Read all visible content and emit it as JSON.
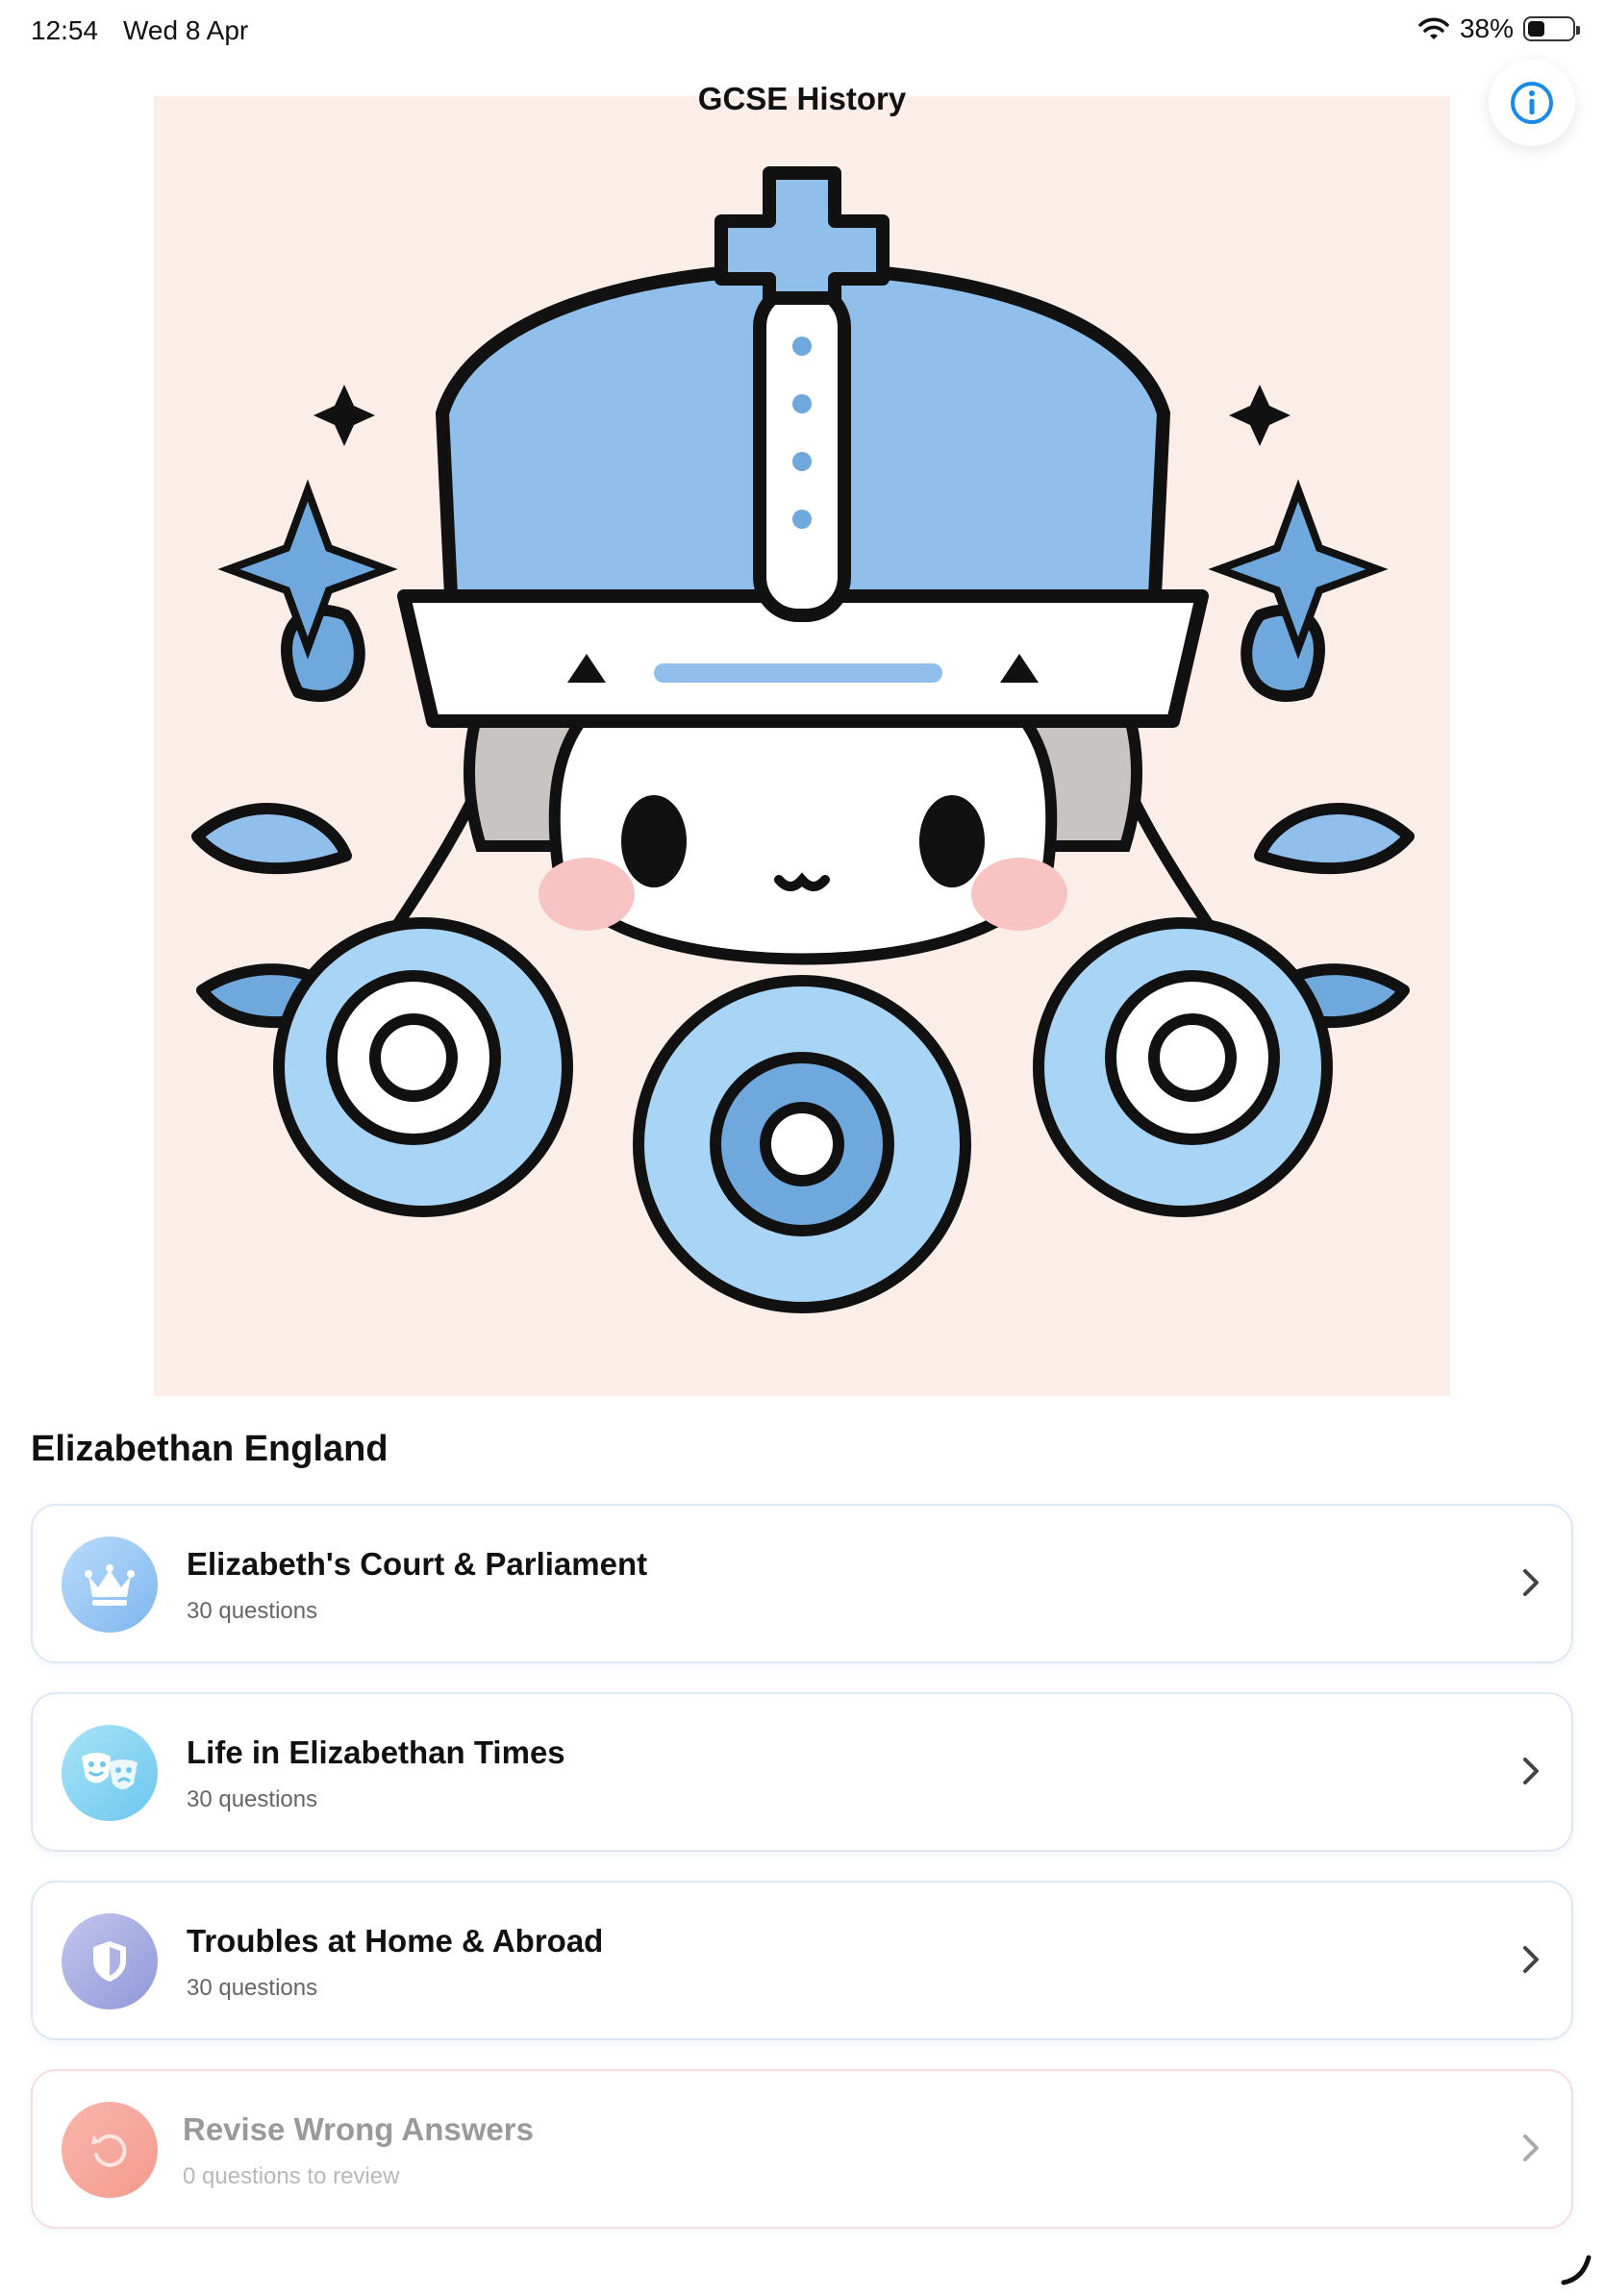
{
  "status_bar": {
    "time": "12:54",
    "date": "Wed 8 Apr",
    "battery": "38%",
    "battery_level": 0.38
  },
  "nav": {
    "title": "GCSE History",
    "info_icon": "info-icon"
  },
  "section": {
    "title": "Elizabethan England"
  },
  "topics": [
    {
      "title": "Elizabeth's Court & Parliament",
      "subtitle": "30 questions",
      "icon": "crown-icon"
    },
    {
      "title": "Life in Elizabethan Times",
      "subtitle": "30 questions",
      "icon": "theater-masks-icon"
    },
    {
      "title": "Troubles at Home & Abroad",
      "subtitle": "30 questions",
      "icon": "shield-icon"
    },
    {
      "title": "Revise Wrong Answers",
      "subtitle": "0 questions to review",
      "icon": "undo-icon",
      "disabled": true
    }
  ],
  "colors": {
    "accent": "#1a8ae6",
    "hero_bg": "#fbeee8",
    "crown_blue": "#8fbfea",
    "revise_red": "#f6a59b"
  }
}
